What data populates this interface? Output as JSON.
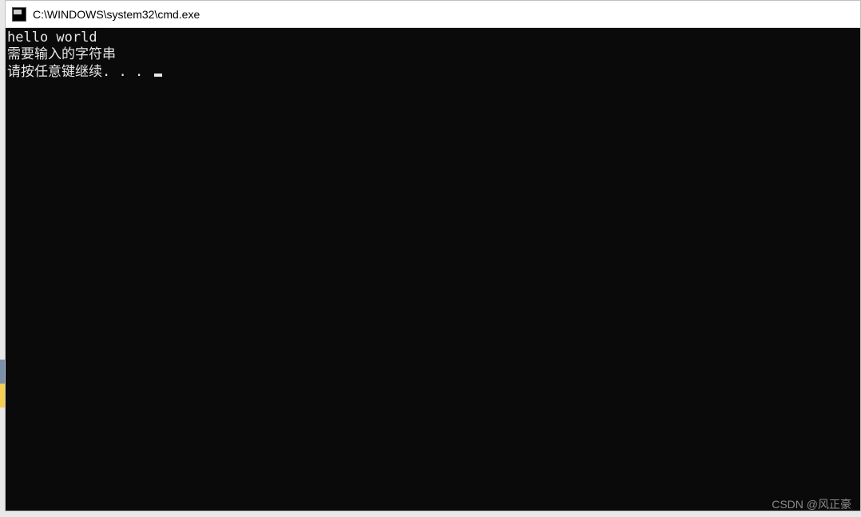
{
  "window": {
    "title": "C:\\WINDOWS\\system32\\cmd.exe"
  },
  "terminal": {
    "lines": [
      "hello world",
      "需要输入的字符串",
      "请按任意键继续. . . "
    ]
  },
  "watermark": "CSDN @风正豪"
}
